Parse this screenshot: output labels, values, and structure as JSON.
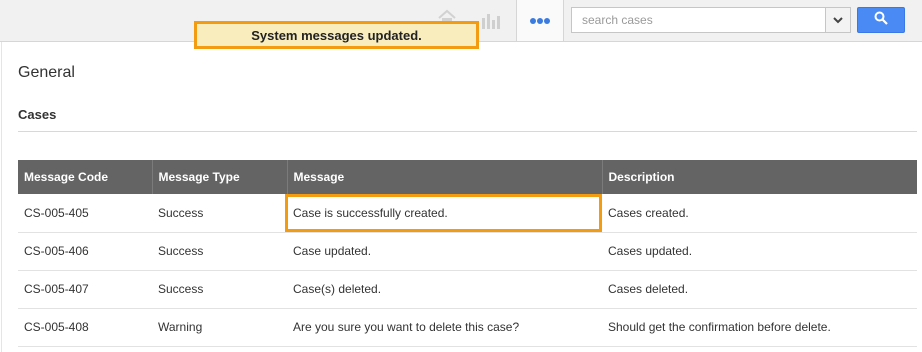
{
  "toast": {
    "text": "System messages updated."
  },
  "topbar": {
    "icons": [
      "home-icon",
      "bar-chart-icon"
    ],
    "more_icon": "more-dots-icon"
  },
  "search": {
    "placeholder": "search cases",
    "dropdown_icon": "chevron-down-icon",
    "button_icon": "search-icon"
  },
  "page": {
    "title": "General",
    "section": "Cases"
  },
  "table": {
    "columns": [
      "Message Code",
      "Message Type",
      "Message",
      "Description"
    ],
    "rows": [
      [
        "CS-005-405",
        "Success",
        "Case is successfully created.",
        "Cases created."
      ],
      [
        "CS-005-406",
        "Success",
        "Case updated.",
        "Cases updated."
      ],
      [
        "CS-005-407",
        "Success",
        "Case(s) deleted.",
        "Cases deleted."
      ],
      [
        "CS-005-408",
        "Warning",
        "Are you sure you want to delete this case?",
        "Should get the confirmation before delete."
      ]
    ]
  },
  "colors": {
    "highlight": "#f39c12",
    "toast_bg": "#f9edbe",
    "header_bg": "#646464",
    "search_button": "#4a8af4"
  }
}
